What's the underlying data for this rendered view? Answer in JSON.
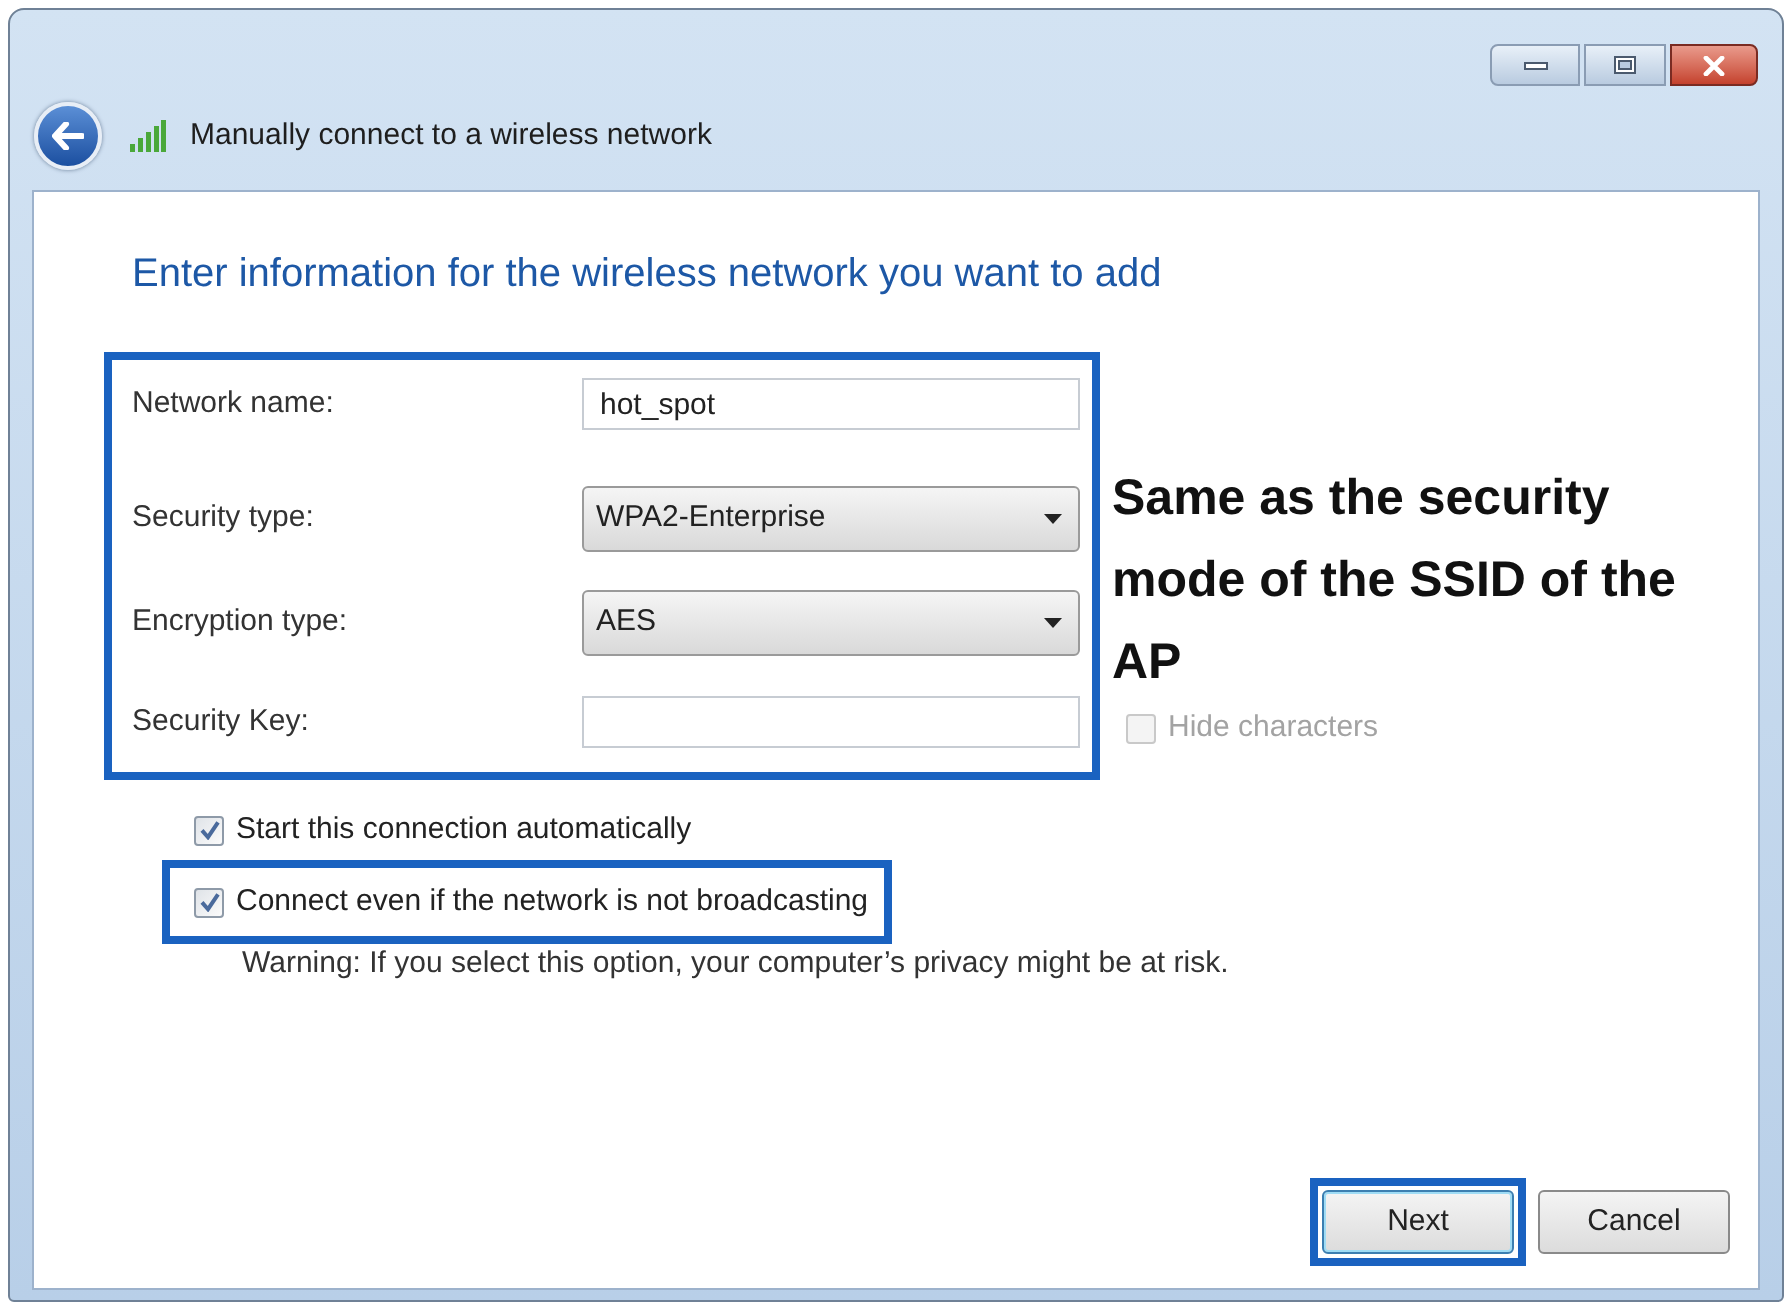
{
  "window": {
    "title": "Manually connect to a wireless network"
  },
  "heading": "Enter information for the wireless network you want to add",
  "form": {
    "highlighted": true,
    "fields": [
      {
        "kind": "text",
        "label": "Network name:",
        "value": "hot_spot"
      },
      {
        "kind": "select",
        "label": "Security type:",
        "value": "WPA2-Enterprise"
      },
      {
        "kind": "select",
        "label": "Encryption type:",
        "value": "AES"
      },
      {
        "kind": "text",
        "label": "Security Key:"
      }
    ]
  },
  "annotation": "Same as the security mode of the SSID of the AP",
  "hide_characters": {
    "label": "Hide characters",
    "checked": false,
    "disabled": true
  },
  "options": [
    {
      "label": "Start this connection automatically",
      "checked": true,
      "highlighted": false
    },
    {
      "label": "Connect even if the network is not broadcasting",
      "checked": true,
      "highlighted": true
    }
  ],
  "warning": "Warning: If you select this option, your computer’s privacy might be at risk.",
  "buttons": [
    {
      "label": "Next",
      "highlighted": true
    },
    {
      "label": "Cancel",
      "highlighted": false
    }
  ]
}
